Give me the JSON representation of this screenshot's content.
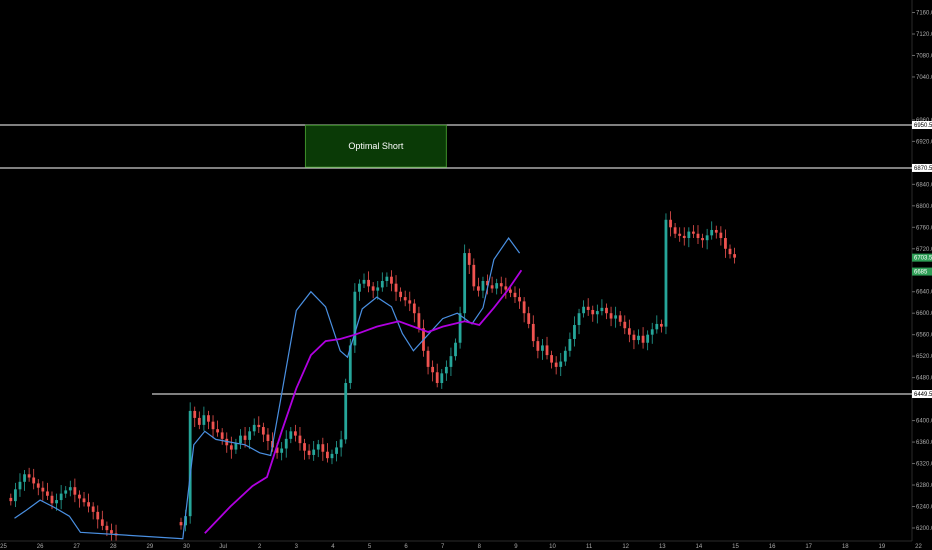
{
  "chart_data": {
    "type": "candlestick",
    "y_ticks": [
      6200,
      6240,
      6280,
      6320,
      6360,
      6400,
      6480,
      6520,
      6560,
      6600,
      6640,
      6720,
      6760,
      6800,
      6840,
      6920,
      6960,
      7040,
      7080,
      7120,
      7160
    ],
    "y_tick_labels": [
      "6200.0",
      "6240.0",
      "6280.0",
      "6320.0",
      "6360.0",
      "6400.0",
      "6480.0",
      "6520.0",
      "6560.0",
      "6600.0",
      "6640.0",
      "6720.0",
      "6760.0",
      "6800.0",
      "6840.0",
      "6920.0",
      "6960.0",
      "7040.0",
      "7080.0",
      "7120.0",
      "7160.0"
    ],
    "ylim": [
      6186,
      7170
    ],
    "x_labels": [
      "25",
      "26",
      "27",
      "28",
      "29",
      "30",
      "Jul",
      "2",
      "3",
      "4",
      "5",
      "6",
      "7",
      "8",
      "9",
      "10",
      "11",
      "12",
      "13",
      "14",
      "15",
      "16",
      "17",
      "18",
      "19",
      "22"
    ],
    "horizontal_levels": [
      {
        "value": 6950.5,
        "label": "6950.5"
      },
      {
        "value": 6870.5,
        "label": "6870.5"
      },
      {
        "value": 6449.5,
        "label": "6449.5"
      }
    ],
    "zone": {
      "label": "Optimal Short",
      "y_top": 6950,
      "y_bottom": 6872,
      "x_start_day": 8.25,
      "x_end_day": 12.1
    },
    "current_price_tag": {
      "value": 6703.5,
      "label": "6703.5"
    },
    "ma_price_tag": {
      "value": 6685,
      "label": "6685"
    },
    "candle_start_day": 0.2,
    "candle_step_day": 0.125,
    "candle_groups": [
      {
        "start_day": 0.2,
        "closes": [
          6250,
          6272,
          6286,
          6300,
          6294,
          6283,
          6275,
          6268,
          6260,
          6246,
          6252,
          6264,
          6270,
          6276,
          6262,
          6255,
          6248,
          6240,
          6230,
          6216,
          6204,
          6196,
          6190,
          6186
        ]
      },
      {
        "start_day": 4.85,
        "closes": [
          6205,
          6222,
          6418,
          6405,
          6392,
          6410,
          6398,
          6384,
          6378,
          6366,
          6354,
          6346,
          6358,
          6372,
          6364,
          6380,
          6392,
          6388,
          6374,
          6362,
          6350,
          6340,
          6348,
          6366,
          6380,
          6372,
          6358,
          6344,
          6336,
          6346,
          6356,
          6342,
          6330,
          6338,
          6350,
          6365,
          6470,
          6540,
          6640,
          6655,
          6662,
          6650,
          6642,
          6648,
          6660,
          6668,
          6655,
          6640,
          6630,
          6624,
          6618,
          6600,
          6572,
          6530,
          6500,
          6490,
          6470,
          6488,
          6500,
          6520,
          6545,
          6600,
          6712,
          6690,
          6650,
          6642,
          6660,
          6652,
          6646,
          6656,
          6650,
          6644,
          6638,
          6630,
          6622,
          6600,
          6580,
          6548,
          6530,
          6540,
          6522,
          6508,
          6500,
          6510,
          6530,
          6552,
          6578,
          6600,
          6612,
          6606,
          6598,
          6604,
          6610,
          6600,
          6590,
          6596,
          6584,
          6572,
          6560,
          6550,
          6558,
          6545,
          6560,
          6570,
          6580,
          6575,
          6774,
          6760,
          6748,
          6744,
          6740,
          6752,
          6748,
          6740,
          6736,
          6745,
          6755,
          6750,
          6740,
          6720,
          6710,
          6703.5
        ]
      }
    ],
    "ema_fast": {
      "color": "#4a90e2",
      "points": [
        [
          0.3,
          6218
        ],
        [
          0.6,
          6232
        ],
        [
          1.0,
          6252
        ],
        [
          1.4,
          6238
        ],
        [
          1.8,
          6222
        ],
        [
          2.1,
          6192
        ],
        [
          4.9,
          6180
        ],
        [
          5.2,
          6355
        ],
        [
          5.5,
          6380
        ],
        [
          5.8,
          6365
        ],
        [
          6.2,
          6360
        ],
        [
          6.6,
          6355
        ],
        [
          7.0,
          6340
        ],
        [
          7.3,
          6335
        ],
        [
          7.6,
          6450
        ],
        [
          8.0,
          6605
        ],
        [
          8.4,
          6640
        ],
        [
          8.8,
          6612
        ],
        [
          9.2,
          6530
        ],
        [
          9.4,
          6518
        ],
        [
          9.8,
          6608
        ],
        [
          10.2,
          6630
        ],
        [
          10.6,
          6612
        ],
        [
          10.9,
          6562
        ],
        [
          11.2,
          6530
        ],
        [
          11.6,
          6560
        ],
        [
          12.0,
          6590
        ],
        [
          12.4,
          6600
        ],
        [
          12.8,
          6580
        ],
        [
          13.1,
          6610
        ],
        [
          13.4,
          6700
        ],
        [
          13.8,
          6740
        ],
        [
          14.1,
          6712
        ]
      ]
    },
    "ema_slow": {
      "color": "#b000e0",
      "points": [
        [
          5.5,
          6190
        ],
        [
          6.2,
          6240
        ],
        [
          6.8,
          6278
        ],
        [
          7.2,
          6295
        ],
        [
          7.6,
          6380
        ],
        [
          8.0,
          6460
        ],
        [
          8.4,
          6522
        ],
        [
          8.8,
          6548
        ],
        [
          9.2,
          6552
        ],
        [
          9.6,
          6560
        ],
        [
          10.2,
          6575
        ],
        [
          10.8,
          6585
        ],
        [
          11.2,
          6575
        ],
        [
          11.6,
          6565
        ],
        [
          12.0,
          6575
        ],
        [
          12.6,
          6585
        ],
        [
          13.0,
          6578
        ],
        [
          13.4,
          6610
        ],
        [
          13.8,
          6645
        ],
        [
          14.15,
          6680
        ]
      ]
    },
    "colors": {
      "up": "#26a69a",
      "down": "#ef5350",
      "background": "#000000",
      "level_line": "#ffffff",
      "zone_fill": "#0a3a06",
      "zone_border": "#3e8f2a",
      "price_tag": "#2e9e56"
    }
  }
}
